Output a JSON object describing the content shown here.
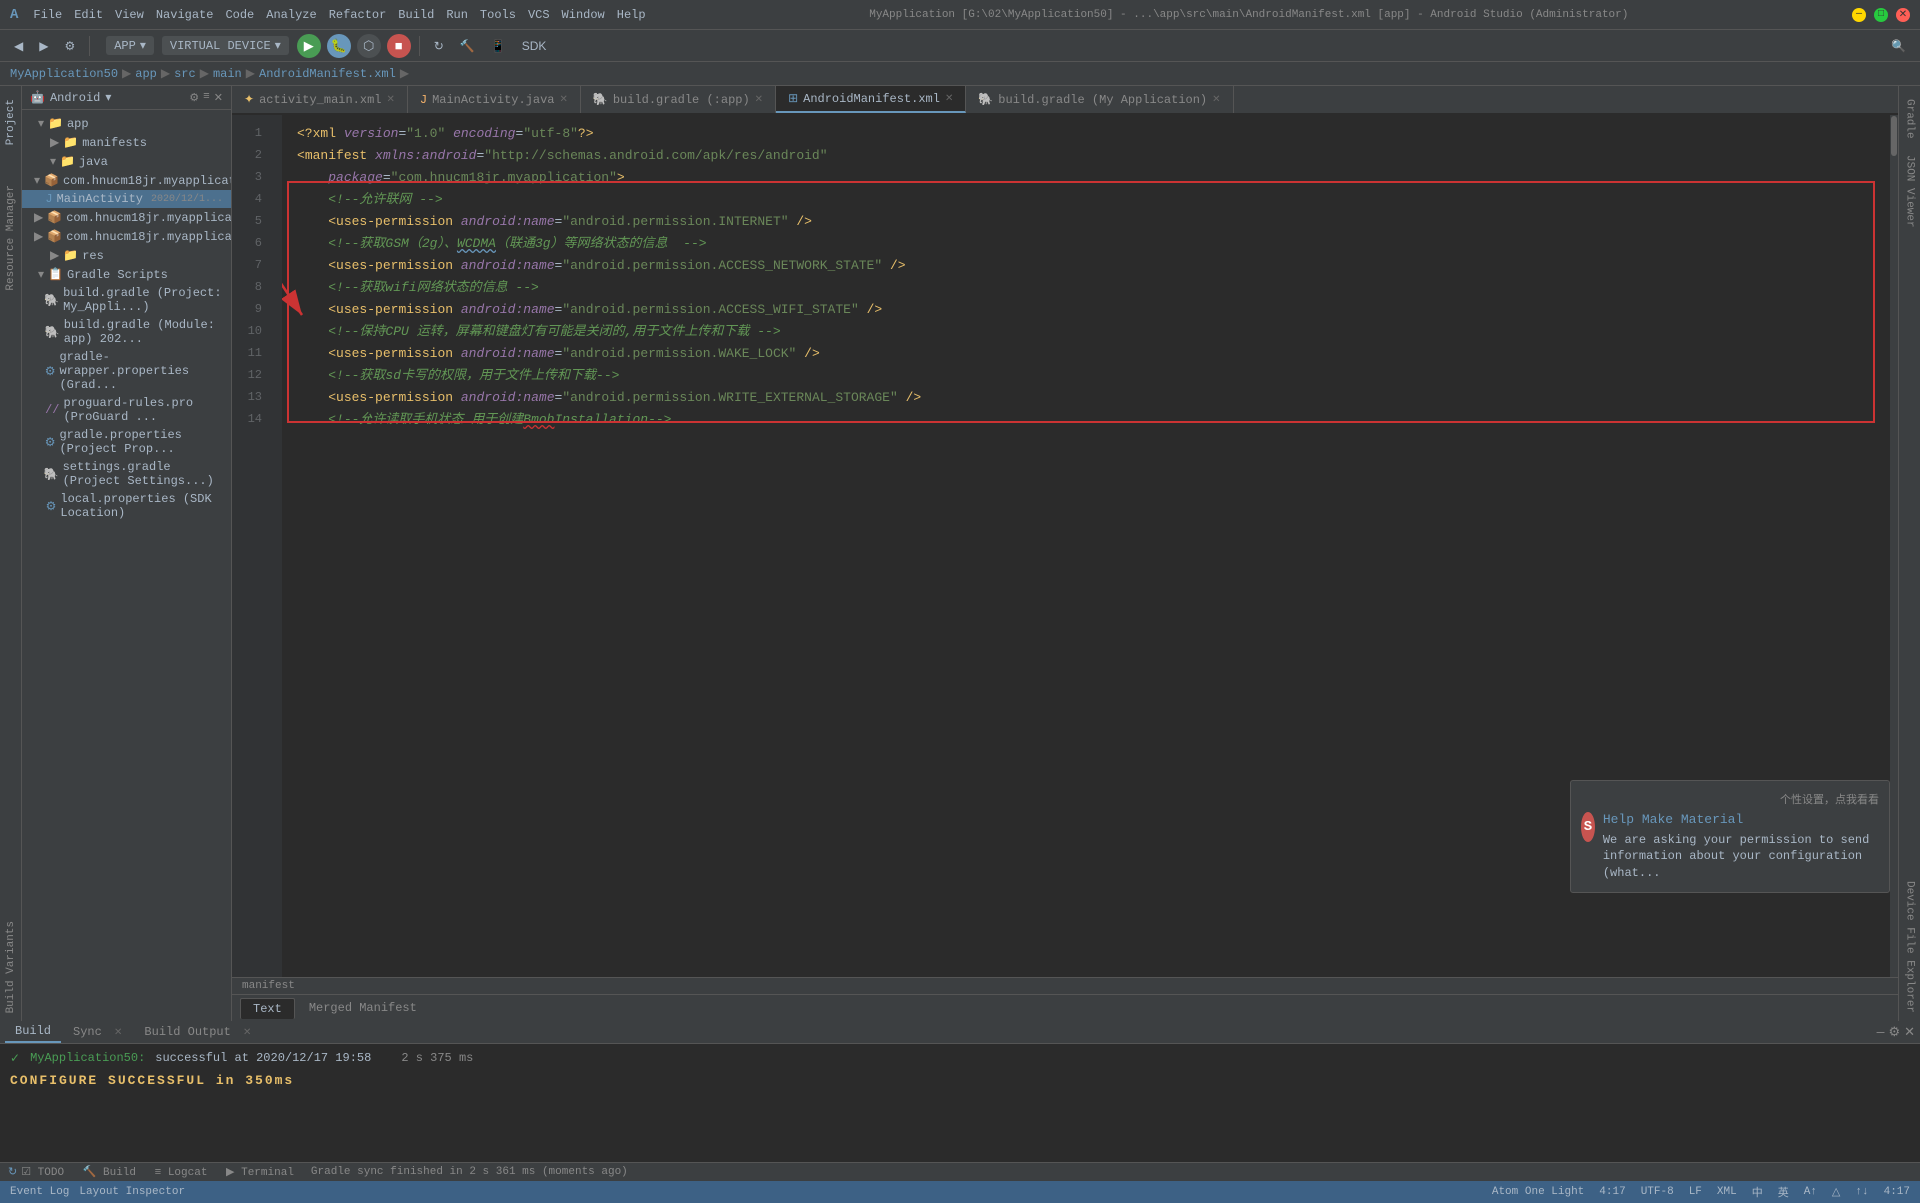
{
  "titlebar": {
    "title": "MyApplication [G:\\02\\MyApplication50] - ...\\app\\src\\main\\AndroidManifest.xml [app] - Android Studio (Administrator)",
    "menu_items": [
      "File",
      "Edit",
      "View",
      "Navigate",
      "Code",
      "Analyze",
      "Refactor",
      "Build",
      "Run",
      "Tools",
      "VCS",
      "Window",
      "Help"
    ]
  },
  "toolbar": {
    "app_label": "APP",
    "device_label": "VIRTUAL DEVICE"
  },
  "breadcrumb": {
    "items": [
      "MyApplication50",
      "app",
      "src",
      "main",
      "AndroidManifest.xml"
    ]
  },
  "project_panel": {
    "title": "Android",
    "items": [
      {
        "label": "app",
        "type": "folder",
        "level": 0,
        "expanded": true
      },
      {
        "label": "manifests",
        "type": "folder",
        "level": 1,
        "expanded": false
      },
      {
        "label": "java",
        "type": "folder",
        "level": 1,
        "expanded": true
      },
      {
        "label": "com.hnucm18jr.myapplicatio...",
        "type": "package",
        "level": 2,
        "expanded": true
      },
      {
        "label": "MainActivity",
        "type": "file",
        "level": 3,
        "date": "2020/12/1..."
      },
      {
        "label": "com.hnucm18jr.myapplicatio...",
        "type": "package",
        "level": 2,
        "expanded": false
      },
      {
        "label": "com.hnucm18jr.myapplicatio...",
        "type": "package",
        "level": 2,
        "expanded": false
      },
      {
        "label": "res",
        "type": "folder",
        "level": 1,
        "expanded": false
      },
      {
        "label": "Gradle Scripts",
        "type": "folder",
        "level": 0,
        "expanded": true
      },
      {
        "label": "build.gradle (Project: My_Appli...)",
        "type": "gradle",
        "level": 1
      },
      {
        "label": "build.gradle (Module: app) 202...",
        "type": "gradle",
        "level": 1
      },
      {
        "label": "gradle-wrapper.properties (Grad...",
        "type": "properties",
        "level": 1
      },
      {
        "label": "proguard-rules.pro (ProGuard ...",
        "type": "proguard",
        "level": 1
      },
      {
        "label": "gradle.properties (Project Prop...",
        "type": "properties",
        "level": 1
      },
      {
        "label": "settings.gradle (Project Settings...)",
        "type": "gradle",
        "level": 1
      },
      {
        "label": "local.properties (SDK Location)",
        "type": "properties",
        "level": 1
      }
    ]
  },
  "editor_tabs": [
    {
      "label": "activity_main.xml",
      "type": "xml",
      "active": false,
      "closable": true
    },
    {
      "label": "MainActivity.java",
      "type": "java",
      "active": false,
      "closable": true
    },
    {
      "label": "build.gradle (:app)",
      "type": "gradle",
      "active": false,
      "closable": true
    },
    {
      "label": "AndroidManifest.xml",
      "type": "manifest",
      "active": true,
      "closable": true
    },
    {
      "label": "build.gradle (My Application)",
      "type": "gradle",
      "active": false,
      "closable": true
    }
  ],
  "code_lines": [
    {
      "num": 1,
      "code": "<?xml version=\"1.0\" encoding=\"utf-8\"?>"
    },
    {
      "num": 2,
      "code": "<manifest xmlns:android=\"http://schemas.android.com/apk/res/android\""
    },
    {
      "num": 3,
      "code": "    package=\"com.hnucm18jr.myapplication\">"
    },
    {
      "num": 4,
      "code": "    <!--允许联网 -->"
    },
    {
      "num": 5,
      "code": "    <uses-permission android:name=\"android.permission.INTERNET\" />"
    },
    {
      "num": 6,
      "code": "    <!--获取GSM（2g）、WCDMA（联通3g）等网络状态的信息  -->"
    },
    {
      "num": 7,
      "code": "    <uses-permission android:name=\"android.permission.ACCESS_NETWORK_STATE\" />"
    },
    {
      "num": 8,
      "code": "    <!--获取wifi网络状态的信息 -->"
    },
    {
      "num": 9,
      "code": "    <uses-permission android:name=\"android.permission.ACCESS_WIFI_STATE\" />"
    },
    {
      "num": 10,
      "code": "    <!--保持CPU 运转，屏幕和键盘灯有可能是关闭的,用于文件上传和下载 -->"
    },
    {
      "num": 11,
      "code": "    <uses-permission android:name=\"android.permission.WAKE_LOCK\" />"
    },
    {
      "num": 12,
      "code": "    <!--获取sd卡写的权限，用于文件上传和下载-->"
    },
    {
      "num": 13,
      "code": "    <uses-permission android:name=\"android.permission.WRITE_EXTERNAL_STORAGE\" />"
    },
    {
      "num": 14,
      "code": "    <!--允许读取手机状态 用于创建BmobInstallation-->"
    }
  ],
  "bottom_tabs": [
    {
      "label": "Text",
      "active": true
    },
    {
      "label": "Merged Manifest",
      "active": false
    }
  ],
  "build_panel": {
    "tabs": [
      {
        "label": "Build",
        "active": true,
        "closable": false
      },
      {
        "label": "Sync",
        "active": false,
        "closable": true
      },
      {
        "label": "Build Output",
        "active": false,
        "closable": true
      }
    ],
    "messages": [
      {
        "check": true,
        "app": "MyApplication50:",
        "detail": "successful at 2020/12/17 19:58",
        "duration": "2 s 375 ms"
      }
    ],
    "bottom_text": "CONFIGURE SUCCESSFUL in 350ms"
  },
  "status_bar": {
    "sync_msg": "Gradle sync finished in 2 s 361 ms (moments ago)",
    "items": [
      "TODO",
      "Build",
      "Logcat",
      "Terminal"
    ],
    "right_items": [
      "Event Log",
      "Layout Inspector"
    ],
    "theme": "Atom One Light",
    "time": "4:17",
    "status_icons": [
      "中",
      "英"
    ]
  },
  "notification": {
    "header": "个性设置，点我看看",
    "title": "Help Make Material",
    "subtitle": "We are asking your permission to send information about your configuration (what..."
  },
  "left_tabs": [
    "Project",
    "Resource Manager",
    "Build Variants"
  ],
  "right_tabs": [
    "Gradle",
    "JSON Viewer",
    "Device File Explorer"
  ]
}
